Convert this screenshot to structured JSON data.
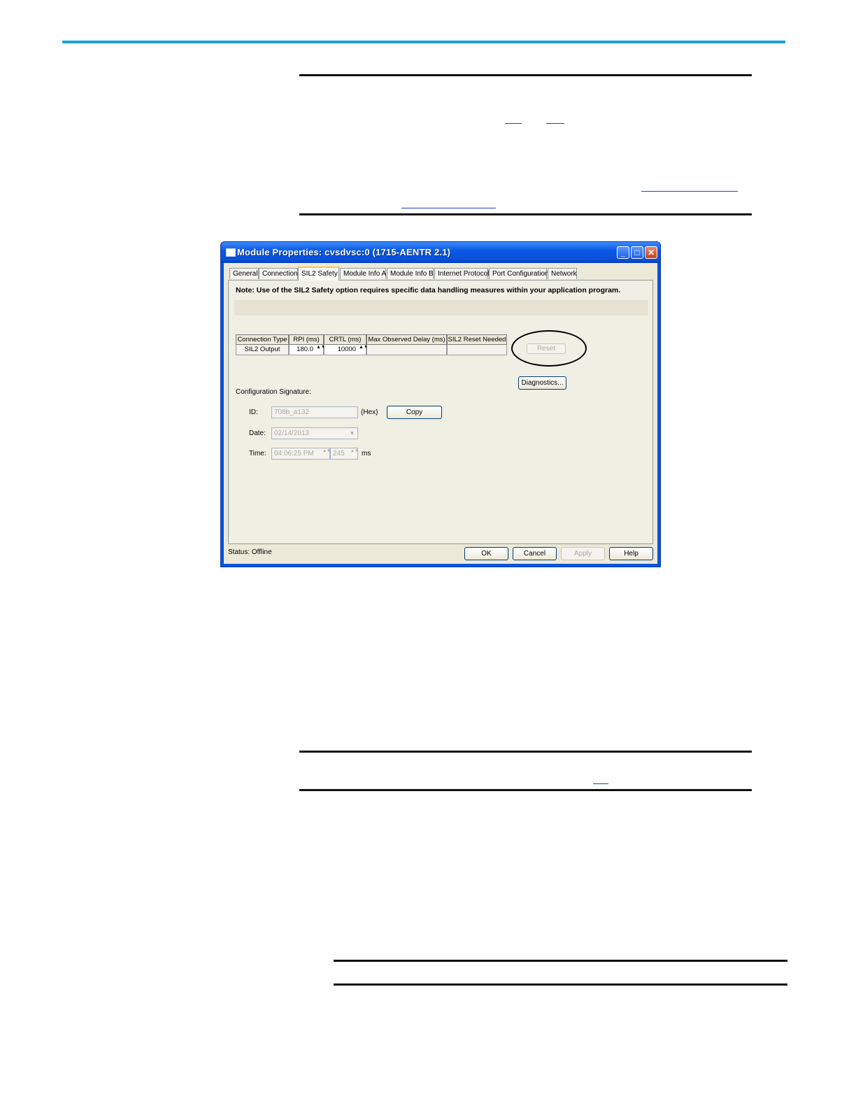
{
  "dialog": {
    "title": "Module Properties: cvsdvsc:0 (1715-AENTR 2.1)",
    "window_buttons": {
      "minimize": "_",
      "maximize": "□",
      "close": "✕"
    },
    "tabs": [
      {
        "label": "General"
      },
      {
        "label": "Connection"
      },
      {
        "label": "SIL2 Safety"
      },
      {
        "label": "Module Info A"
      },
      {
        "label": "Module Info B"
      },
      {
        "label": "Internet Protocol"
      },
      {
        "label": "Port Configuration"
      },
      {
        "label": "Network"
      }
    ],
    "active_tab": "SIL2 Safety",
    "note": "Note: Use of the SIL2 Safety option requires specific data handling measures within your application program.",
    "grid": {
      "headers": [
        "Connection Type",
        "RPI (ms)",
        "CRTL (ms)",
        "Max Observed Delay (ms)",
        "SIL2 Reset Needed"
      ],
      "row": {
        "connection_type": "SIL2 Output",
        "rpi": "180.0",
        "crtl": "10000",
        "max_observed_delay": "",
        "sil2_reset_needed": ""
      }
    },
    "reset_label": "Reset",
    "diagnostics_label": "Diagnostics...",
    "config_signature": {
      "heading": "Configuration Signature:",
      "id_label": "ID:",
      "id_value": "708b_a132",
      "hex_label": "(Hex)",
      "copy_label": "Copy",
      "date_label": "Date:",
      "date_value": "02/14/2013",
      "time_label": "Time:",
      "time_value": "04:06:25 PM",
      "ms_value": "245",
      "ms_label": "ms"
    },
    "status": "Status:  Offline",
    "buttons": {
      "ok": "OK",
      "cancel": "Cancel",
      "apply": "Apply",
      "help": "Help"
    },
    "spin_glyph": "▲▼",
    "dropdown_glyph": "▼"
  },
  "colors": {
    "accent_rule": "#1ea1dc",
    "titlebar": "#0a55e0",
    "dialog_face": "#ece9d8"
  }
}
